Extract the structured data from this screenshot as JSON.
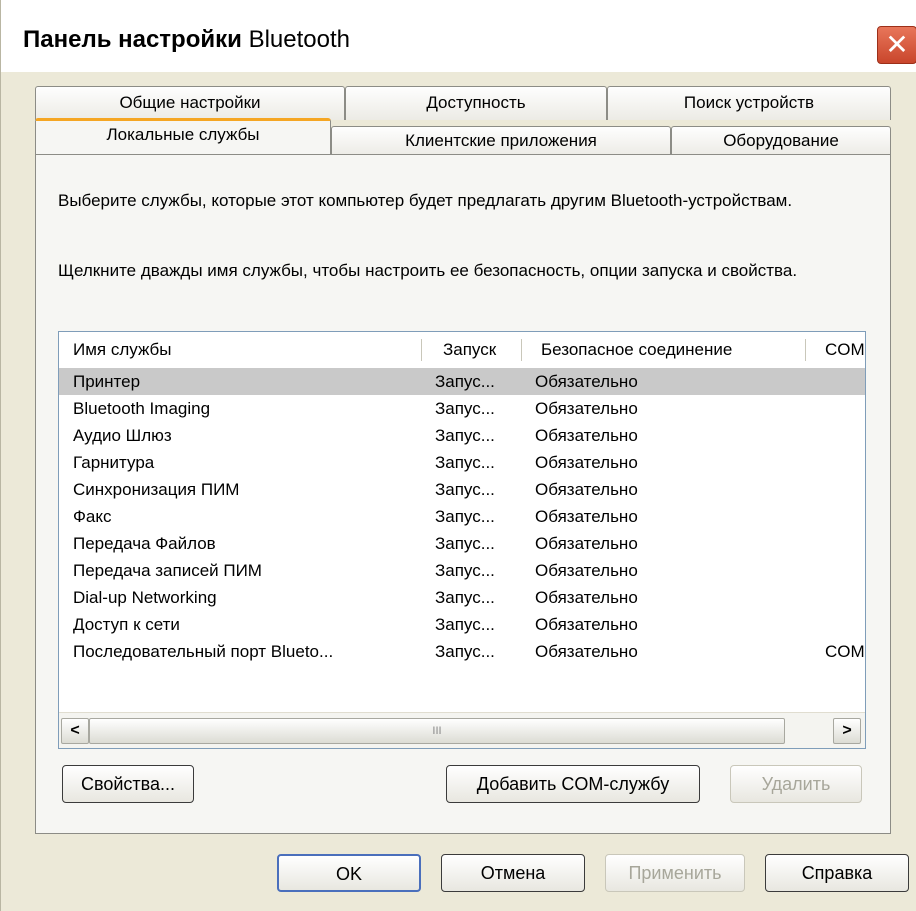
{
  "window": {
    "title_bold": "Панель настройки",
    "title_rest": " Bluetooth",
    "close_symbol": "✕"
  },
  "tabs": {
    "back_row": [
      "Общие настройки",
      "Доступность",
      "Поиск устройств"
    ],
    "front_row": [
      "Локальные службы",
      "Клиентские приложения",
      "Оборудование"
    ],
    "active": "Локальные службы"
  },
  "panel": {
    "desc1": "Выберите службы, которые этот компьютер будет предлагать другим Bluetooth-устройствам.",
    "desc2": "Щелкните дважды имя службы, чтобы настроить ее безопасность, опции запуска и свойства."
  },
  "list": {
    "columns": [
      "Имя службы",
      "Запуск",
      "Безопасное соединение",
      "COM"
    ],
    "rows": [
      {
        "name": "Принтер",
        "start": "Запус...",
        "secure": "Обязательно",
        "com": "",
        "selected": true
      },
      {
        "name": "Bluetooth Imaging",
        "start": "Запус...",
        "secure": "Обязательно",
        "com": ""
      },
      {
        "name": "Аудио Шлюз",
        "start": "Запус...",
        "secure": "Обязательно",
        "com": ""
      },
      {
        "name": "Гарнитура",
        "start": "Запус...",
        "secure": "Обязательно",
        "com": ""
      },
      {
        "name": "Синхронизация ПИМ",
        "start": "Запус...",
        "secure": "Обязательно",
        "com": ""
      },
      {
        "name": "Факс",
        "start": "Запус...",
        "secure": "Обязательно",
        "com": ""
      },
      {
        "name": "Передача Файлов",
        "start": "Запус...",
        "secure": "Обязательно",
        "com": ""
      },
      {
        "name": "Передача записей ПИМ",
        "start": "Запус...",
        "secure": "Обязательно",
        "com": ""
      },
      {
        "name": "Dial-up Networking",
        "start": "Запус...",
        "secure": "Обязательно",
        "com": ""
      },
      {
        "name": "Доступ к сети",
        "start": "Запус...",
        "secure": "Обязательно",
        "com": ""
      },
      {
        "name": "Последовательный порт Blueto...",
        "start": "Запус...",
        "secure": "Обязательно",
        "com": "COM"
      }
    ],
    "scroll_left": "<",
    "scroll_right": ">",
    "scroll_grip": "III"
  },
  "buttons": {
    "properties": "Свойства...",
    "add_com": "Добавить COM-службу",
    "delete": "Удалить",
    "ok": "OK",
    "cancel": "Отмена",
    "apply": "Применить",
    "help": "Справка"
  }
}
